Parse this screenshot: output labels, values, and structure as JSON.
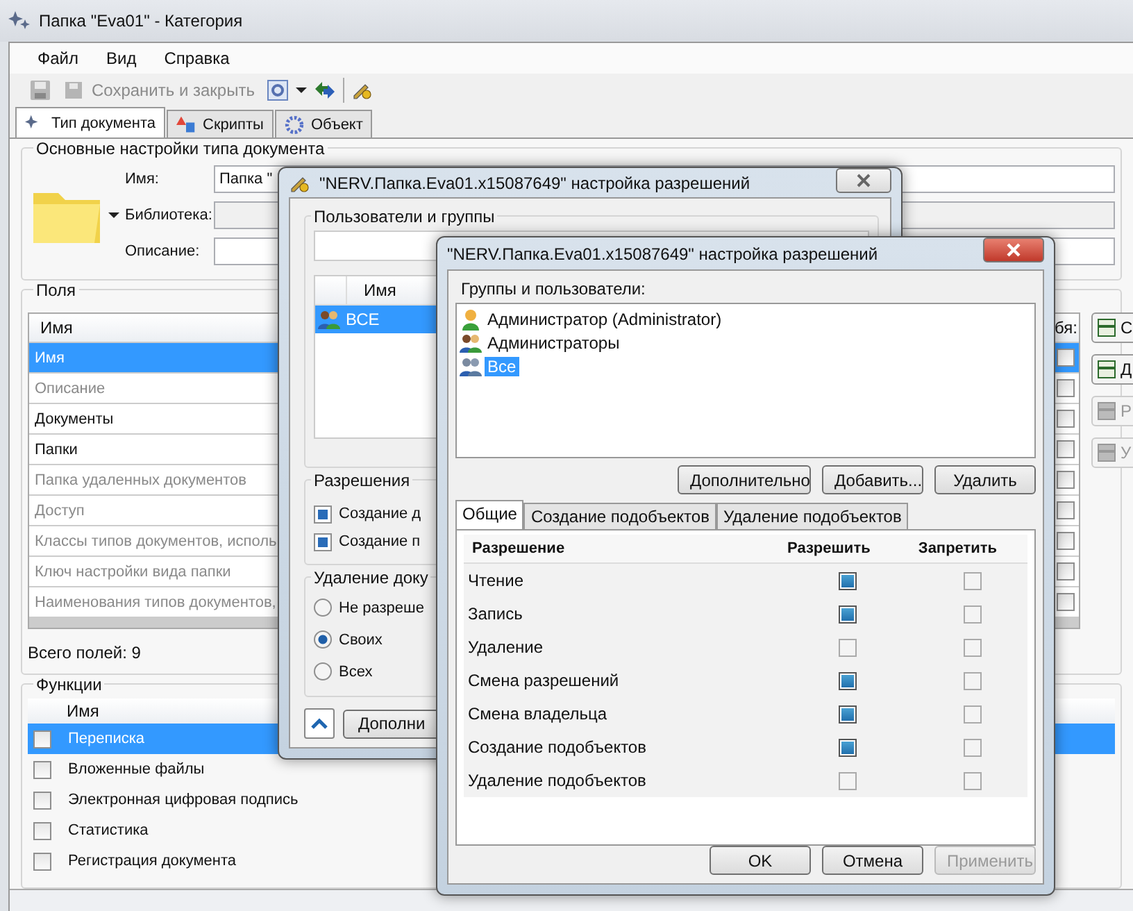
{
  "window": {
    "title": "Папка \"Eva01\" - Категория"
  },
  "menu": [
    "Файл",
    "Вид",
    "Справка"
  ],
  "toolbar": {
    "save_close": {
      "label": "Сохранить и закрыть",
      "disabled": true
    }
  },
  "tabs": [
    {
      "label": "Тип документа",
      "selected": true
    },
    {
      "label": "Скрипты",
      "selected": false
    },
    {
      "label": "Объект",
      "selected": false
    }
  ],
  "basic_settings": {
    "title": "Основные настройки типа документа",
    "fields": [
      {
        "label": "Имя:",
        "value": "Папка \"",
        "disabled": false
      },
      {
        "label": "Библиотека:",
        "disabled": true
      },
      {
        "label": "Описание:",
        "disabled": false
      }
    ]
  },
  "fields_group": {
    "title": "Поля",
    "columns": [
      "Имя",
      "бя:"
    ],
    "rows": [
      {
        "name": "Имя",
        "selected": true,
        "disabled": false,
        "checked": false
      },
      {
        "name": "Описание",
        "selected": false,
        "disabled": true,
        "checked": false
      },
      {
        "name": "Документы",
        "selected": false,
        "disabled": false,
        "checked": false
      },
      {
        "name": "Папки",
        "selected": false,
        "disabled": false,
        "checked": false
      },
      {
        "name": "Папка удаленных документов",
        "selected": false,
        "disabled": true,
        "checked": false
      },
      {
        "name": "Доступ",
        "selected": false,
        "disabled": true,
        "checked": false
      },
      {
        "name": "Классы типов документов, исполь",
        "selected": false,
        "disabled": true,
        "checked": false
      },
      {
        "name": "Ключ настройки вида папки",
        "selected": false,
        "disabled": true,
        "checked": false
      },
      {
        "name": "Наименования типов документов,",
        "selected": false,
        "disabled": true,
        "checked": false
      }
    ],
    "total": "Всего полей: 9",
    "side_buttons": [
      {
        "label": "С",
        "disabled": false
      },
      {
        "label": "Д",
        "disabled": false
      },
      {
        "label": "Р",
        "disabled": true
      },
      {
        "label": "У",
        "disabled": true
      }
    ]
  },
  "functions": {
    "title": "Функции",
    "column": "Имя",
    "rows": [
      {
        "name": "Переписка",
        "selected": true,
        "checked": false
      },
      {
        "name": "Вложенные файлы",
        "selected": false,
        "checked": false
      },
      {
        "name": "Электронная цифровая подпись",
        "selected": false,
        "checked": false
      },
      {
        "name": "Статистика",
        "selected": false,
        "checked": false
      },
      {
        "name": "Регистрация документа",
        "selected": false,
        "checked": false
      }
    ]
  },
  "dialog_back": {
    "title": "\"NERV.Папка.Eva01.x15087649\" настройка разрешений",
    "users_title": "Пользователи и группы",
    "column": "Имя",
    "users": [
      {
        "name": "ВСЕ",
        "selected": true
      }
    ],
    "permissions_title": "Разрешения",
    "permissions": [
      {
        "label": "Создание д",
        "checked": true
      },
      {
        "label": "Создание п",
        "checked": true
      }
    ],
    "deletion_title": "Удаление доку",
    "deletion": [
      {
        "label": "Не разреше",
        "selected": false
      },
      {
        "label": "Своих",
        "selected": true
      },
      {
        "label": "Всех",
        "selected": false
      }
    ],
    "more_button": "Дополни"
  },
  "dialog_front": {
    "title": "\"NERV.Папка.Eva01.x15087649\" настройка разрешений",
    "users_title": "Группы и пользователи:",
    "users": [
      {
        "name": "Администратор (Administrator)",
        "selected": false,
        "kind": "user"
      },
      {
        "name": "Администраторы",
        "selected": false,
        "kind": "group"
      },
      {
        "name": "Все",
        "selected": true,
        "kind": "group"
      }
    ],
    "buttons": [
      "Дополнительно",
      "Добавить...",
      "Удалить"
    ],
    "tabs": [
      {
        "label": "Общие",
        "selected": true
      },
      {
        "label": "Создание подобъектов",
        "selected": false
      },
      {
        "label": "Удаление подобъектов",
        "selected": false
      }
    ],
    "columns": [
      "Разрешение",
      "Разрешить",
      "Запретить"
    ],
    "rows": [
      {
        "name": "Чтение",
        "allow": true,
        "deny": false
      },
      {
        "name": "Запись",
        "allow": true,
        "deny": false
      },
      {
        "name": "Удаление",
        "allow": false,
        "deny": false
      },
      {
        "name": "Смена разрешений",
        "allow": true,
        "deny": false
      },
      {
        "name": "Смена владельца",
        "allow": true,
        "deny": false
      },
      {
        "name": "Создание подобъектов",
        "allow": true,
        "deny": false
      },
      {
        "name": "Удаление подобъектов",
        "allow": false,
        "deny": false
      }
    ],
    "footer": [
      {
        "label": "OK",
        "disabled": false
      },
      {
        "label": "Отмена",
        "disabled": false
      },
      {
        "label": "Применить",
        "disabled": true
      }
    ]
  }
}
